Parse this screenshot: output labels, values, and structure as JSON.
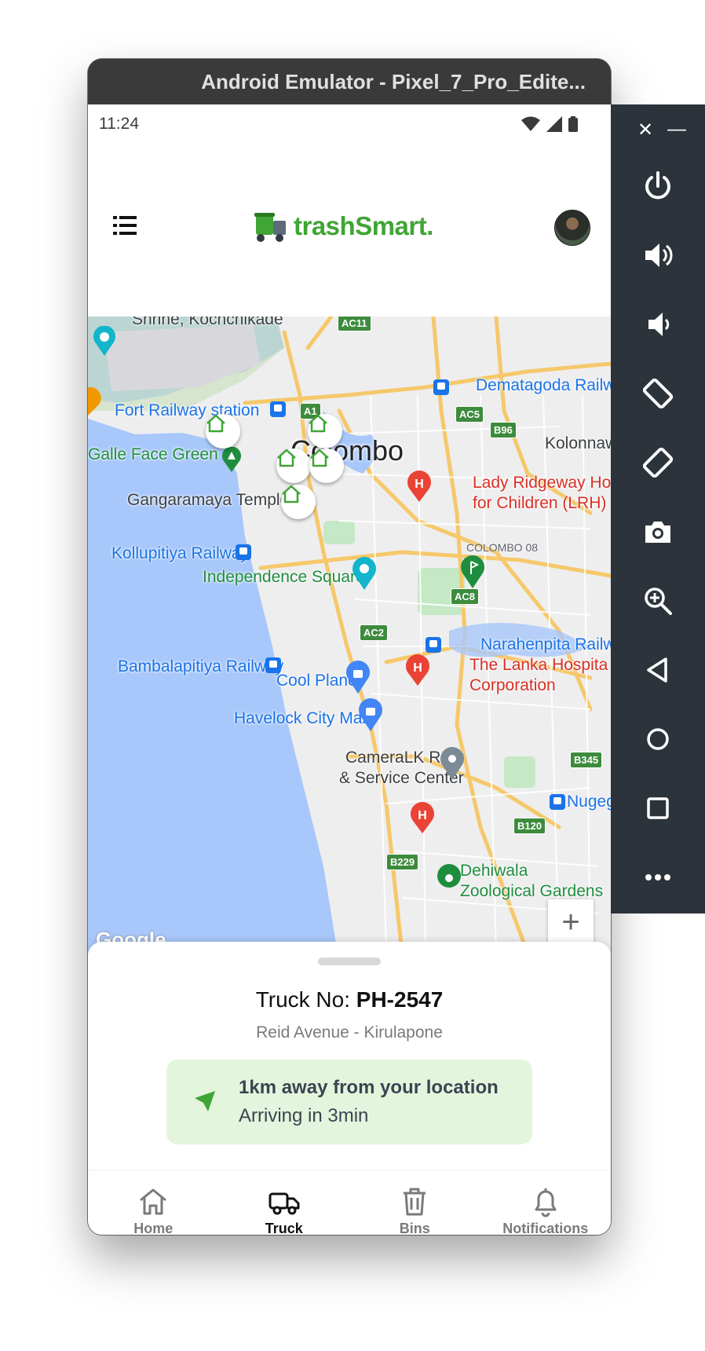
{
  "window": {
    "title": "Android Emulator - Pixel_7_Pro_Edite..."
  },
  "status_bar": {
    "time": "11:24",
    "icons": [
      "wifi-icon",
      "signal-icon",
      "battery-icon"
    ]
  },
  "app_bar": {
    "logo_text": "trashSmart.",
    "menu_icon": "menu-icon",
    "avatar": "user-avatar"
  },
  "map": {
    "labels": {
      "shrine": "Shrine, Kochchikade",
      "dematagoda": "Dematagoda Railw",
      "fort": "Fort Railway station",
      "galle_face": "Galle Face Green",
      "colombo": "Colombo",
      "kolonnawa": "Kolonnaw",
      "lady_ridgeway_1": "Lady Ridgeway Ho",
      "lady_ridgeway_2": "for Children (LRH)",
      "gangaramaya": "Gangaramaya Temple",
      "kollupitiya": "Kollupitiya Railway",
      "colombo08": "COLOMBO 08",
      "independence": "Independence Square",
      "narahenpita": "Narahenpita Railwa",
      "lanka_hospital_1": "The Lanka Hospita",
      "lanka_hospital_2": "Corporation",
      "bambalapitiya": "Bambalapitiya Railway",
      "cool_planet": "Cool Planet",
      "havelock": "Havelock City Mall",
      "cameralk_1": "CameraLK Rent",
      "cameralk_2": "& Service Center",
      "nugegoda": "Nugeg",
      "dehiwala_1": "Dehiwala",
      "dehiwala_2": "Zoological Gardens",
      "google": "Google"
    },
    "road_shields": [
      "AC11",
      "A1",
      "AC5",
      "B96",
      "AC8",
      "AC2",
      "B345",
      "B120",
      "B229"
    ],
    "zoom_in": "+",
    "zoom_out": "−"
  },
  "sheet": {
    "truck_prefix": "Truck No: ",
    "truck_no": "PH-2547",
    "route": "Reid Avenue - Kirulapone",
    "eta_title": "1km away from your location",
    "eta_sub": "Arriving in 3min",
    "accent": "#3fa535",
    "card_bg": "#e3f5dc"
  },
  "tabs": [
    {
      "label": "Home",
      "icon": "home-icon",
      "active": false
    },
    {
      "label": "Truck",
      "icon": "truck-icon",
      "active": true
    },
    {
      "label": "Bins",
      "icon": "trash-icon",
      "active": false
    },
    {
      "label": "Notifications",
      "icon": "bell-icon",
      "active": false
    }
  ],
  "side_panel": {
    "close": "✕",
    "minimize": "—",
    "buttons": [
      "power-icon",
      "volume-up-icon",
      "volume-down-icon",
      "rotate-left-icon",
      "rotate-right-icon",
      "camera-icon",
      "zoom-icon",
      "back-icon",
      "home-circle-icon",
      "overview-icon",
      "more-icon"
    ]
  }
}
